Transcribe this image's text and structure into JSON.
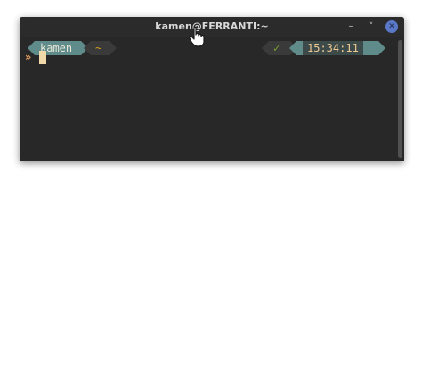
{
  "window": {
    "title": "kamen@FERRANTI:~",
    "controls": {
      "minimize": "–",
      "maximize": "˅",
      "close": "✕"
    }
  },
  "prompt": {
    "user": "kamen",
    "dir": "~",
    "status_icon": "✓",
    "time": "15:34:11",
    "arrow": "»"
  },
  "colors": {
    "segment_accent": "#5f8b8b",
    "segment_dark": "#3a3a3a",
    "dir_color": "#d0a020",
    "status_ok": "#7fa22a",
    "time_color": "#f0c890",
    "cursor": "#f0d8a8",
    "close_button": "#5a78c8"
  },
  "icons": {
    "status": "check-icon",
    "close": "close-icon",
    "minimize": "minimize-icon",
    "maximize": "maximize-icon",
    "pointer": "mouse-pointer-icon"
  }
}
